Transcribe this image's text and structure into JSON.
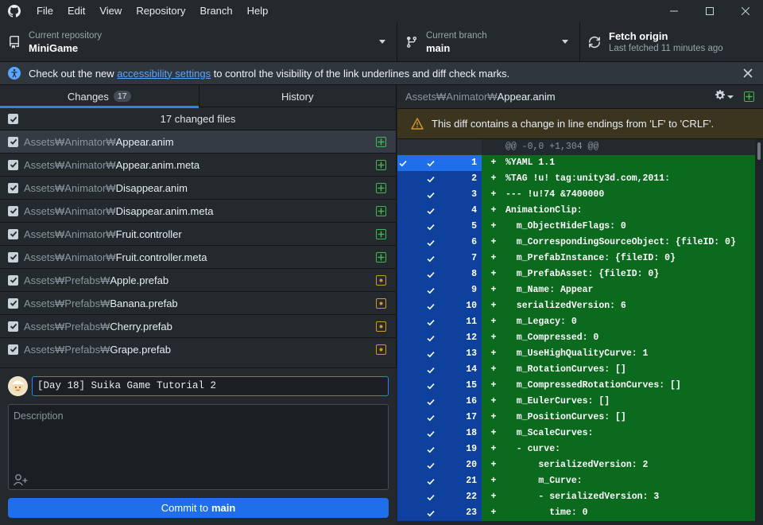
{
  "menu": [
    "File",
    "Edit",
    "View",
    "Repository",
    "Branch",
    "Help"
  ],
  "toolbar": {
    "repo_label": "Current repository",
    "repo_value": "MiniGame",
    "branch_label": "Current branch",
    "branch_value": "main",
    "fetch_title": "Fetch origin",
    "fetch_sub": "Last fetched 11 minutes ago"
  },
  "banner": {
    "before": "Check out the new ",
    "link": "accessibility settings",
    "after": " to control the visibility of the link underlines and diff check marks."
  },
  "tabs": {
    "changes": "Changes",
    "changes_count": "17",
    "history": "History"
  },
  "changes": {
    "header": "17 changed files",
    "files": [
      {
        "dir": "Assets₩Animator₩",
        "name": "Appear.anim",
        "status": "added",
        "selected": true
      },
      {
        "dir": "Assets₩Animator₩",
        "name": "Appear.anim.meta",
        "status": "added"
      },
      {
        "dir": "Assets₩Animator₩",
        "name": "Disappear.anim",
        "status": "added"
      },
      {
        "dir": "Assets₩Animator₩",
        "name": "Disappear.anim.meta",
        "status": "added"
      },
      {
        "dir": "Assets₩Animator₩",
        "name": "Fruit.controller",
        "status": "added"
      },
      {
        "dir": "Assets₩Animator₩",
        "name": "Fruit.controller.meta",
        "status": "added"
      },
      {
        "dir": "Assets₩Prefabs₩",
        "name": "Apple.prefab",
        "status": "modified"
      },
      {
        "dir": "Assets₩Prefabs₩",
        "name": "Banana.prefab",
        "status": "modified"
      },
      {
        "dir": "Assets₩Prefabs₩",
        "name": "Cherry.prefab",
        "status": "modified"
      },
      {
        "dir": "Assets₩Prefabs₩",
        "name": "Grape.prefab",
        "status": "modified"
      }
    ]
  },
  "commit": {
    "summary_value": "[Day 18] Suika Game Tutorial 2",
    "description_placeholder": "Description",
    "button_prefix": "Commit to",
    "button_branch": "main"
  },
  "diff": {
    "path_dir": "Assets₩Animator₩",
    "path_name": "Appear.anim",
    "warning": "This diff contains a change in line endings from 'LF' to 'CRLF'.",
    "hunk": "@@ -0,0 +1,304 @@",
    "lines": [
      {
        "num": "1",
        "code": "%YAML 1.1"
      },
      {
        "num": "2",
        "code": "%TAG !u! tag:unity3d.com,2011:"
      },
      {
        "num": "3",
        "code": "--- !u!74 &7400000"
      },
      {
        "num": "4",
        "code": "AnimationClip:"
      },
      {
        "num": "5",
        "code": "  m_ObjectHideFlags: 0"
      },
      {
        "num": "6",
        "code": "  m_CorrespondingSourceObject: {fileID: 0}"
      },
      {
        "num": "7",
        "code": "  m_PrefabInstance: {fileID: 0}"
      },
      {
        "num": "8",
        "code": "  m_PrefabAsset: {fileID: 0}"
      },
      {
        "num": "9",
        "code": "  m_Name: Appear"
      },
      {
        "num": "10",
        "code": "  serializedVersion: 6"
      },
      {
        "num": "11",
        "code": "  m_Legacy: 0"
      },
      {
        "num": "12",
        "code": "  m_Compressed: 0"
      },
      {
        "num": "13",
        "code": "  m_UseHighQualityCurve: 1"
      },
      {
        "num": "14",
        "code": "  m_RotationCurves: []"
      },
      {
        "num": "15",
        "code": "  m_CompressedRotationCurves: []"
      },
      {
        "num": "16",
        "code": "  m_EulerCurves: []"
      },
      {
        "num": "17",
        "code": "  m_PositionCurves: []"
      },
      {
        "num": "18",
        "code": "  m_ScaleCurves:"
      },
      {
        "num": "19",
        "code": "  - curve:"
      },
      {
        "num": "20",
        "code": "      serializedVersion: 2"
      },
      {
        "num": "21",
        "code": "      m_Curve:"
      },
      {
        "num": "22",
        "code": "      - serializedVersion: 3"
      },
      {
        "num": "23",
        "code": "        time: 0"
      }
    ]
  },
  "colors": {
    "accent": "#1f6feb",
    "added": "#3fb950",
    "modified": "#d29922",
    "diff_add_bg": "#0b6a1e"
  }
}
